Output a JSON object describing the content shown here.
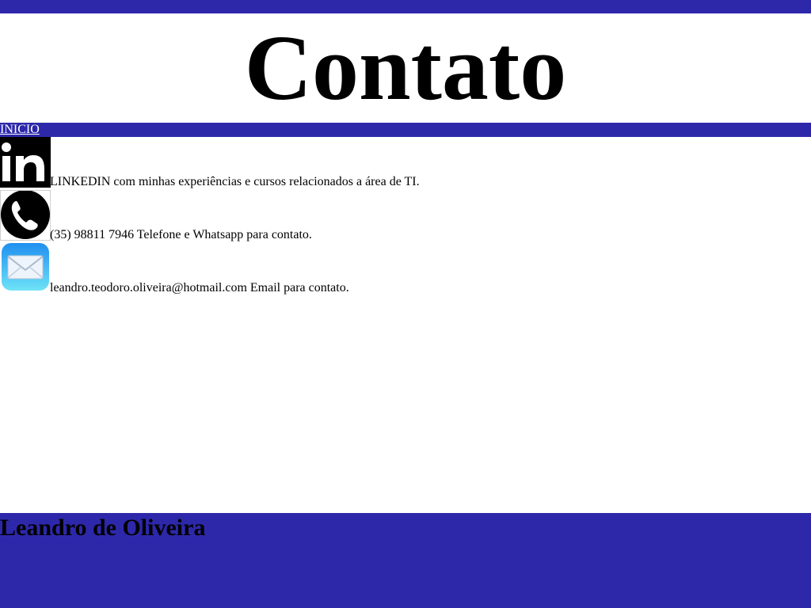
{
  "colors": {
    "brand_blue": "#2d28aa",
    "link_white": "#ffffff",
    "text": "#000000"
  },
  "header": {
    "title": "Contato"
  },
  "nav": {
    "home_label": "INICIO"
  },
  "contacts": [
    {
      "icon": "linkedin-icon",
      "text": "LINKEDIN com minhas experiências e cursos relacionados a área de TI."
    },
    {
      "icon": "phone-icon",
      "text": "(35) 98811 7946 Telefone e Whatsapp para contato."
    },
    {
      "icon": "mail-icon",
      "text": "leandro.teodoro.oliveira@hotmail.com Email para contato."
    }
  ],
  "footer": {
    "name": "Leandro de Oliveira"
  }
}
